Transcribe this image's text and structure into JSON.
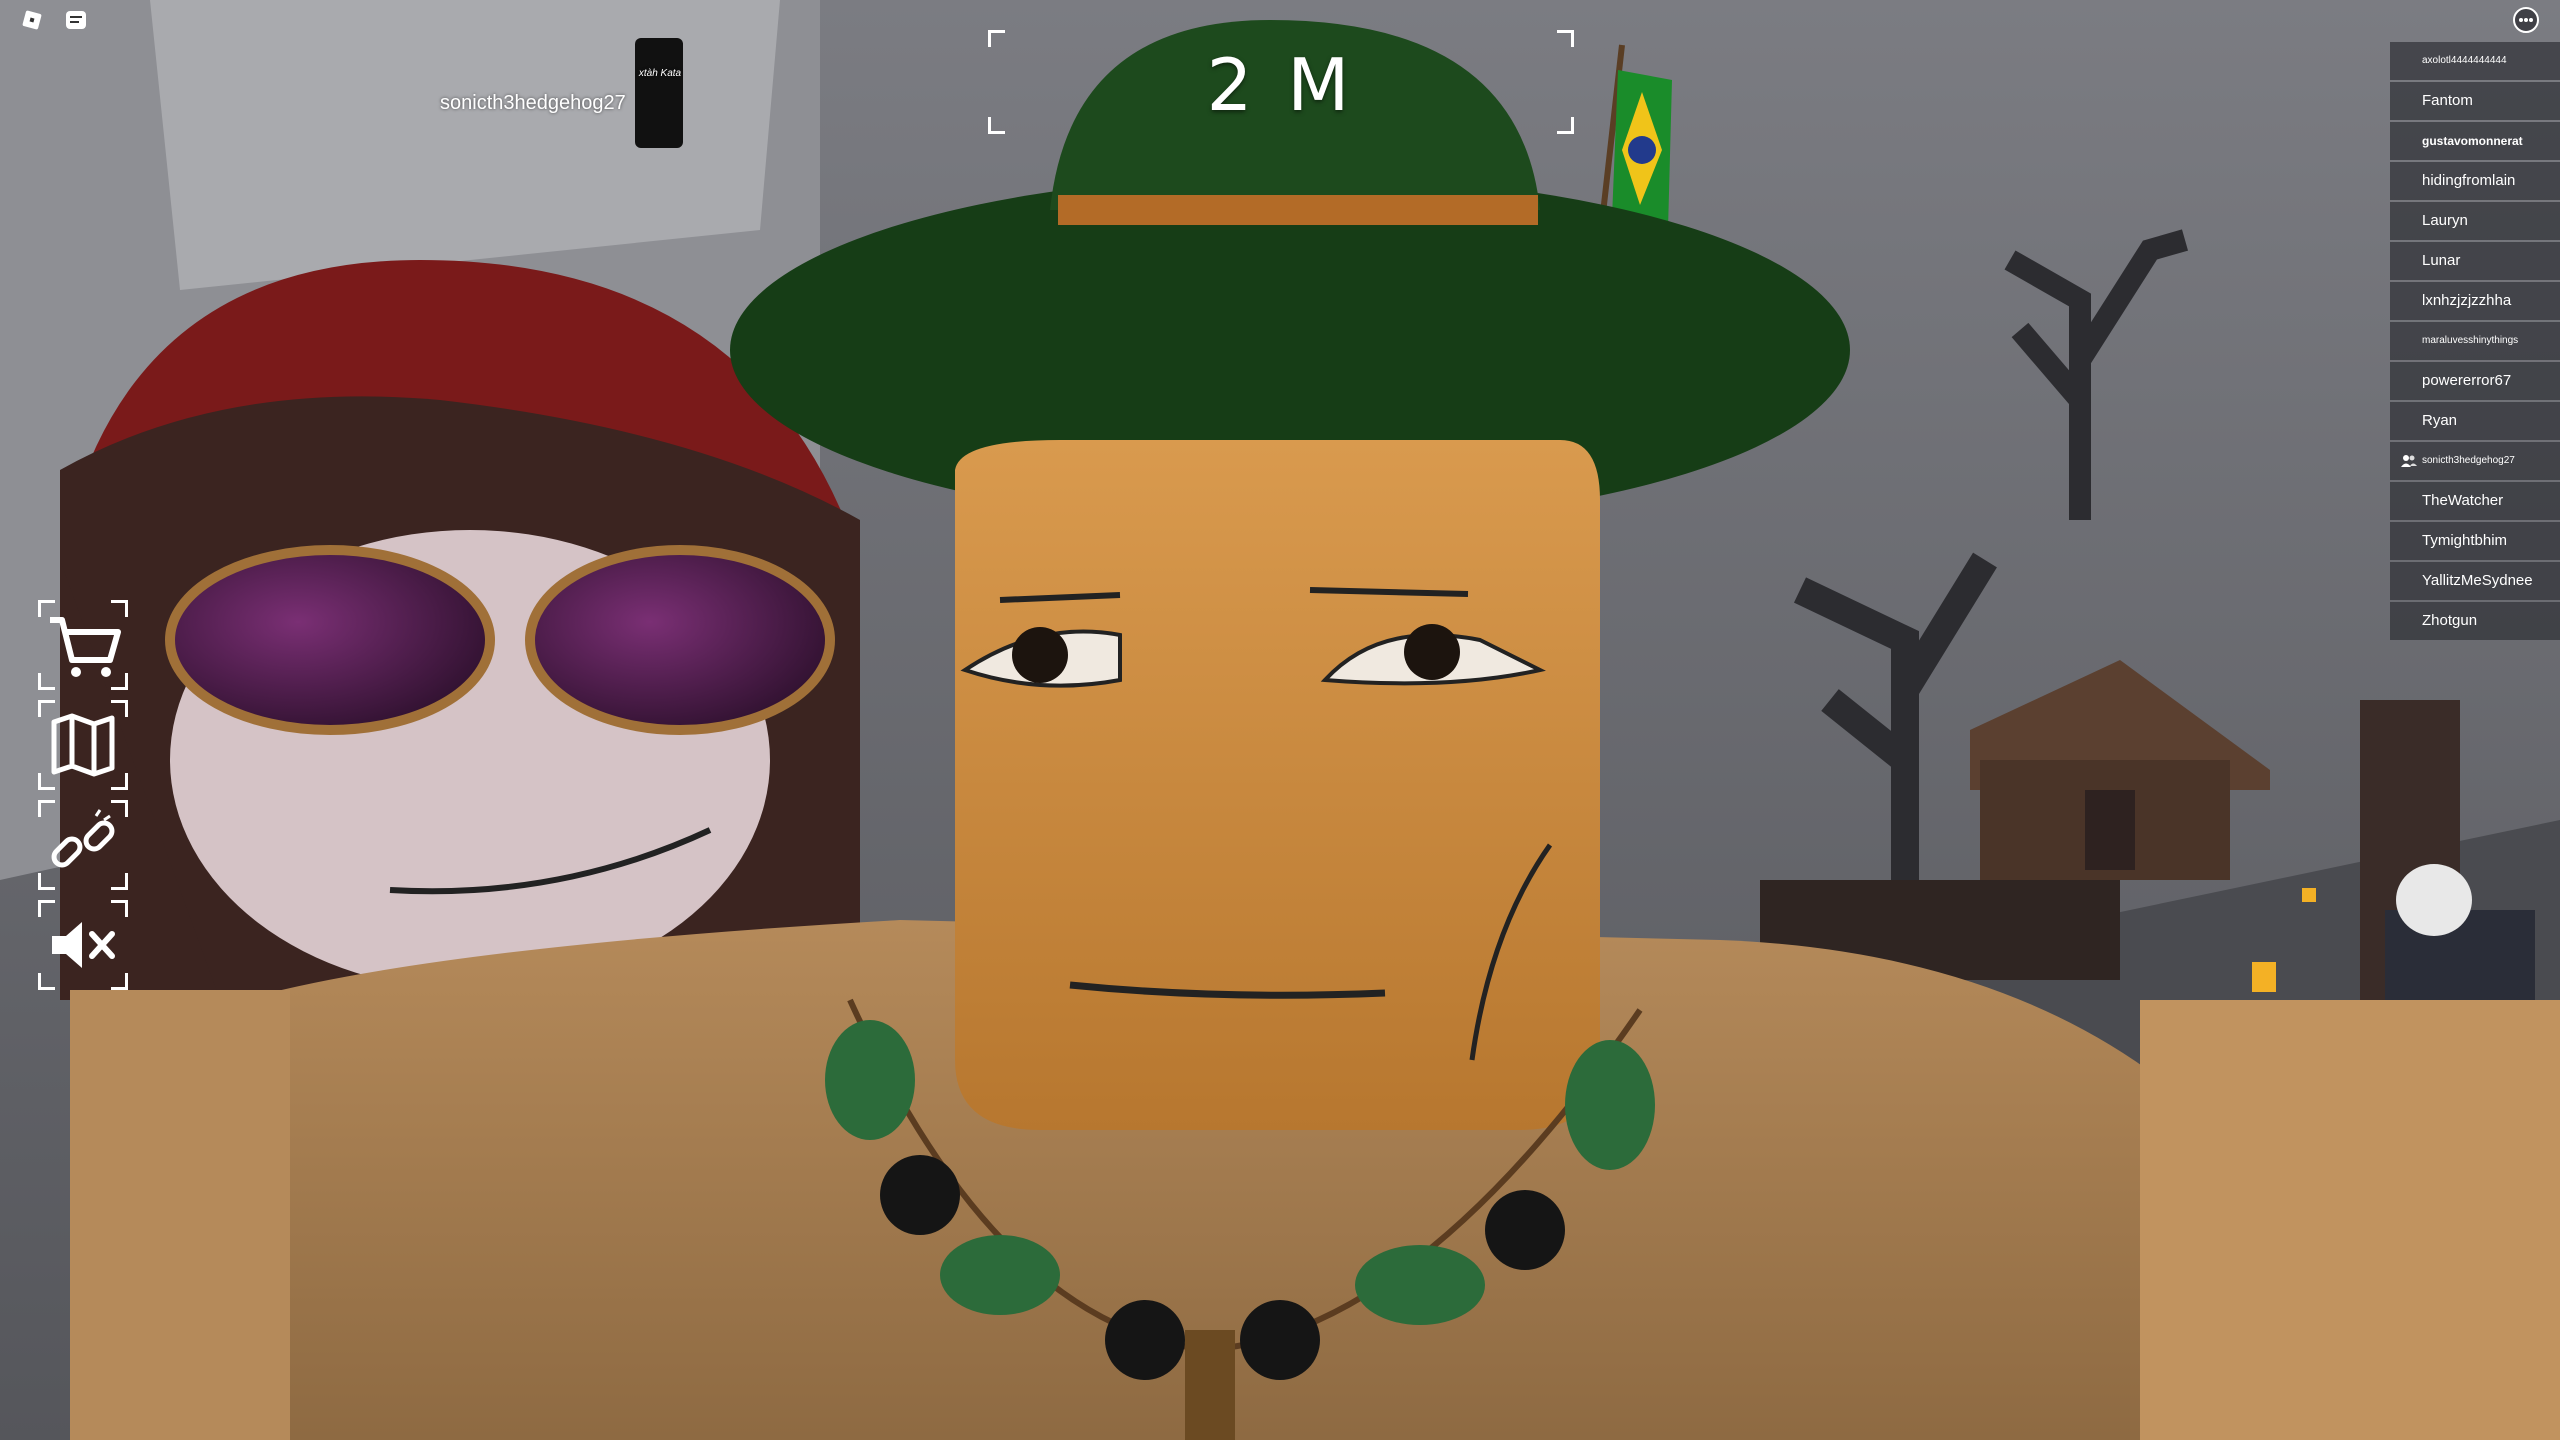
{
  "hud": {
    "timer": "2 M",
    "nametag": "sonicth3hedgehog27",
    "sign_text": "xtàh Kata",
    "menu_buttons": [
      "shop-cart",
      "map",
      "link",
      "mute"
    ]
  },
  "topbar": {
    "roblox_menu": "roblox-logo-icon",
    "chat": "chat-icon",
    "more": "more-options-icon"
  },
  "playerlist": [
    {
      "name": "axolotl4444444444",
      "style": "small"
    },
    {
      "name": "Fantom",
      "style": "normal"
    },
    {
      "name": "gustavomonnerat",
      "style": "bold"
    },
    {
      "name": "hidingfromlain",
      "style": "normal"
    },
    {
      "name": "Lauryn",
      "style": "normal"
    },
    {
      "name": "Lunar",
      "style": "normal"
    },
    {
      "name": "lxnhzjzjzzhha",
      "style": "normal"
    },
    {
      "name": "maraluvesshinythings",
      "style": "small"
    },
    {
      "name": "powererror67",
      "style": "normal"
    },
    {
      "name": "Ryan",
      "style": "normal"
    },
    {
      "name": "sonicth3hedgehog27",
      "style": "small",
      "friend": true
    },
    {
      "name": "TheWatcher",
      "style": "normal"
    },
    {
      "name": "Tymightbhim",
      "style": "normal"
    },
    {
      "name": "YallitzMeSydnee",
      "style": "normal"
    },
    {
      "name": "Zhotgun",
      "style": "normal"
    }
  ],
  "colors": {
    "skin": "#c8873f",
    "hat": "#1d4a1d",
    "hood": "#8c1a1a"
  }
}
